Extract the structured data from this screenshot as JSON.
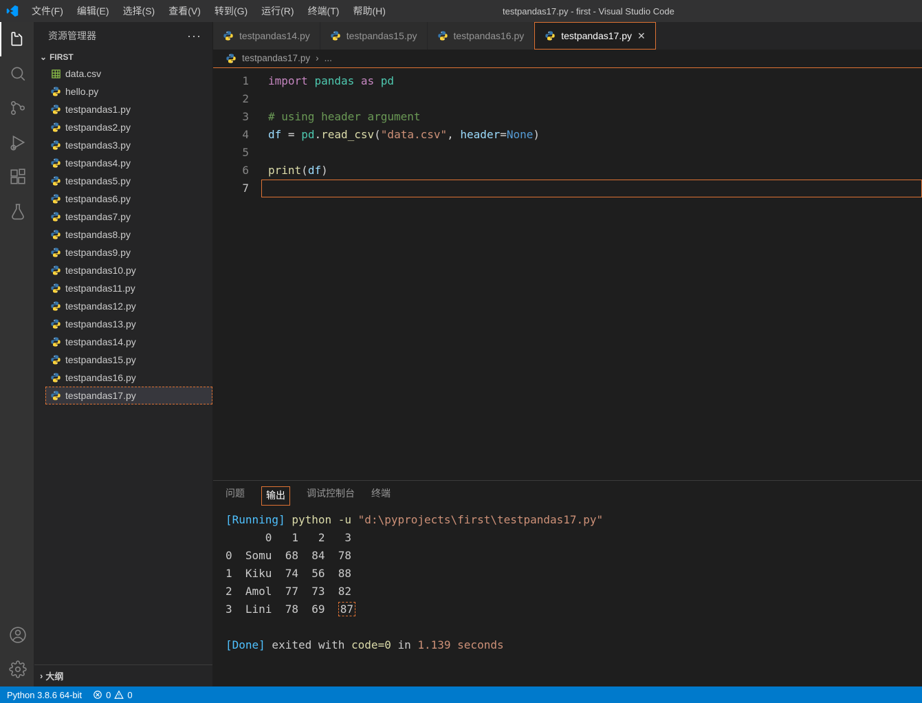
{
  "window_title": "testpandas17.py - first - Visual Studio Code",
  "menu": [
    "文件(F)",
    "编辑(E)",
    "选择(S)",
    "查看(V)",
    "转到(G)",
    "运行(R)",
    "终端(T)",
    "帮助(H)"
  ],
  "sidebar": {
    "title": "资源管理器",
    "folder": "FIRST",
    "outline": "大纲",
    "files": [
      {
        "name": "data.csv",
        "type": "csv"
      },
      {
        "name": "hello.py",
        "type": "py"
      },
      {
        "name": "testpandas1.py",
        "type": "py"
      },
      {
        "name": "testpandas2.py",
        "type": "py"
      },
      {
        "name": "testpandas3.py",
        "type": "py"
      },
      {
        "name": "testpandas4.py",
        "type": "py"
      },
      {
        "name": "testpandas5.py",
        "type": "py"
      },
      {
        "name": "testpandas6.py",
        "type": "py"
      },
      {
        "name": "testpandas7.py",
        "type": "py"
      },
      {
        "name": "testpandas8.py",
        "type": "py"
      },
      {
        "name": "testpandas9.py",
        "type": "py"
      },
      {
        "name": "testpandas10.py",
        "type": "py"
      },
      {
        "name": "testpandas11.py",
        "type": "py"
      },
      {
        "name": "testpandas12.py",
        "type": "py"
      },
      {
        "name": "testpandas13.py",
        "type": "py"
      },
      {
        "name": "testpandas14.py",
        "type": "py"
      },
      {
        "name": "testpandas15.py",
        "type": "py"
      },
      {
        "name": "testpandas16.py",
        "type": "py"
      },
      {
        "name": "testpandas17.py",
        "type": "py",
        "selected": true
      }
    ]
  },
  "tabs": [
    {
      "label": "testpandas14.py"
    },
    {
      "label": "testpandas15.py"
    },
    {
      "label": "testpandas16.py"
    },
    {
      "label": "testpandas17.py",
      "active": true
    }
  ],
  "breadcrumb": {
    "file": "testpandas17.py",
    "tail": "..."
  },
  "code": {
    "lines": [
      {
        "n": 1,
        "html": "<span class='kw'>import</span> <span class='mod'>pandas</span> <span class='kw'>as</span> <span class='mod'>pd</span>"
      },
      {
        "n": 2,
        "html": ""
      },
      {
        "n": 3,
        "html": "<span class='cm'># using header argument</span>"
      },
      {
        "n": 4,
        "html": "<span class='id'>df</span> <span class='pl'>=</span> <span class='mod'>pd</span><span class='pl'>.</span><span class='fn'>read_csv</span><span class='pl'>(</span><span class='str'>\"data.csv\"</span><span class='pl'>,</span> <span class='id'>header</span><span class='pl'>=</span><span class='cn'>None</span><span class='pl'>)</span>"
      },
      {
        "n": 5,
        "html": ""
      },
      {
        "n": 6,
        "html": "<span class='fn'>print</span><span class='pl'>(</span><span class='id'>df</span><span class='pl'>)</span>"
      },
      {
        "n": 7,
        "html": "",
        "current": true
      }
    ]
  },
  "panel": {
    "tabs": [
      "问题",
      "输出",
      "调试控制台",
      "终端"
    ],
    "active": "输出",
    "output": {
      "running_label": "[Running]",
      "cmd": "python -u ",
      "path": "\"d:\\pyprojects\\first\\testpandas17.py\"",
      "table_header": "      0   1   2   3",
      "rows": [
        "0  Somu  68  84  78",
        "1  Kiku  74  56  88",
        "2  Amol  77  73  82"
      ],
      "row_last_pre": "3  Lini  78  69  ",
      "row_last_hi": "87",
      "done_label": "[Done]",
      "done_text": " exited with ",
      "code_text": "code=0",
      "in_text": " in ",
      "time_text": "1.139",
      "sec_text": " seconds"
    }
  },
  "status": {
    "python": "Python 3.8.6 64-bit",
    "errors": "0",
    "warnings": "0"
  }
}
